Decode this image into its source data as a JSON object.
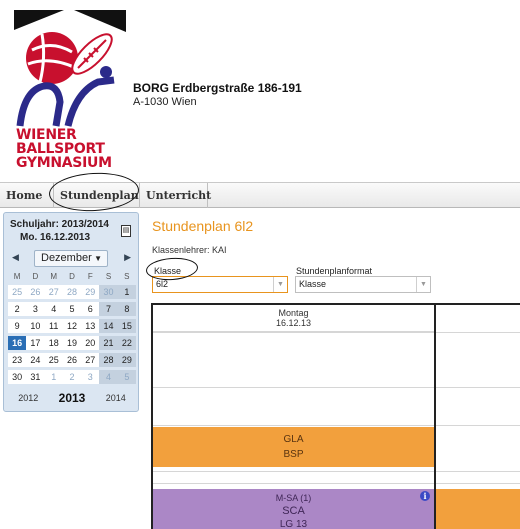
{
  "school": {
    "logo_lines": [
      "WIENER",
      "BALLSPORT",
      "GYMNASIUM"
    ],
    "name": "BORG Erdbergstraße 186-191",
    "address": "A-1030 Wien"
  },
  "nav": {
    "items": [
      "Home",
      "Stundenplan",
      "Unterricht"
    ]
  },
  "sidebar": {
    "schuljahr": "Schuljahr: 2013/2014",
    "date": "Mo. 16.12.2013",
    "month": "Dezember",
    "weekdays": [
      "M",
      "D",
      "M",
      "D",
      "F",
      "S",
      "S"
    ],
    "weeks": [
      [
        "25",
        "26",
        "27",
        "28",
        "29",
        "30",
        "1"
      ],
      [
        "2",
        "3",
        "4",
        "5",
        "6",
        "7",
        "8"
      ],
      [
        "9",
        "10",
        "11",
        "12",
        "13",
        "14",
        "15"
      ],
      [
        "16",
        "17",
        "18",
        "19",
        "20",
        "21",
        "22"
      ],
      [
        "23",
        "24",
        "25",
        "26",
        "27",
        "28",
        "29"
      ],
      [
        "30",
        "31",
        "1",
        "2",
        "3",
        "4",
        "5"
      ]
    ],
    "today": "16",
    "years": [
      "2012",
      "2013",
      "2014"
    ]
  },
  "main": {
    "title": "Stundenplan 6l2",
    "klassenlehrer": "Klassenlehrer: KAI",
    "klasse_label": "Klasse",
    "klasse_value": "6l2",
    "format_label": "Stundenplanformat",
    "format_value": "Klasse"
  },
  "timetable": {
    "day": "Montag",
    "date": "16.12.13",
    "block1": {
      "subject": "GLA",
      "detail": "BSP"
    },
    "block2": {
      "group": "M-SA (1)",
      "subject": "SCA",
      "room": "LG 13"
    }
  },
  "colors": {
    "accent": "#e8941e",
    "orange_block": "#f2a03d",
    "purple_block": "#ab87c6",
    "today": "#2a6eb5",
    "logo_red": "#c8102e",
    "logo_blue": "#2b2a8a"
  }
}
